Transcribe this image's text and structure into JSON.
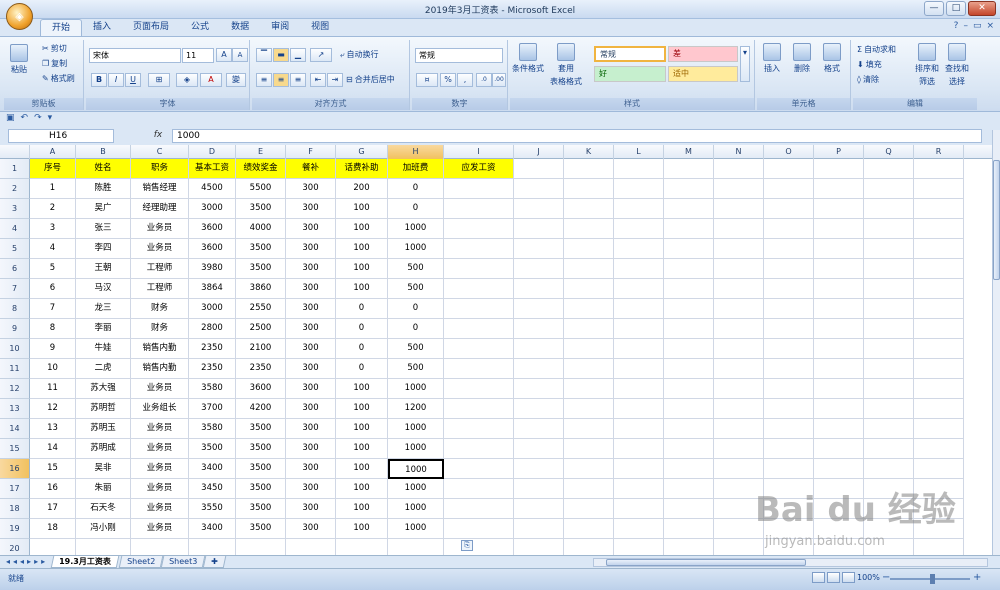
{
  "window": {
    "title": "2019年3月工资表 - Microsoft Excel",
    "controls": [
      "—",
      "□",
      "✕"
    ]
  },
  "ribbon_tabs": [
    "开始",
    "插入",
    "页面布局",
    "公式",
    "数据",
    "审阅",
    "视图"
  ],
  "active_tab": "开始",
  "clipboard": {
    "paste": "粘贴",
    "cut": "剪切",
    "copy": "复制",
    "format_painter": "格式刷",
    "label": "剪贴板"
  },
  "font": {
    "name": "宋体",
    "size": "11",
    "bold": "B",
    "italic": "I",
    "underline": "U",
    "grow": "A",
    "shrink": "A",
    "color_a": "A",
    "label": "字体"
  },
  "alignment": {
    "wrap": "自动换行",
    "merge": "合并后居中",
    "label": "对齐方式"
  },
  "number": {
    "format": "常规",
    "percent": "%",
    "comma": ",",
    "inc": ".0",
    "dec": ".00",
    "label": "数字"
  },
  "styles": {
    "cond_format": "条件格式",
    "table_format_1": "套用",
    "table_format_2": "表格格式",
    "normal": "常规",
    "bad": "差",
    "good": "好",
    "neutral": "适中",
    "label": "样式"
  },
  "cells_group": {
    "insert": "插入",
    "delete": "删除",
    "format": "格式",
    "label": "单元格"
  },
  "editing": {
    "autosum": "自动求和",
    "fill": "填充",
    "clear": "清除",
    "sort_1": "排序和",
    "sort_2": "筛选",
    "find_1": "查找和",
    "find_2": "选择",
    "label": "编辑"
  },
  "formula_bar": {
    "name_box": "H16",
    "fx": "fx",
    "value": "1000"
  },
  "columns": [
    "A",
    "B",
    "C",
    "D",
    "E",
    "F",
    "G",
    "H",
    "I",
    "J",
    "K",
    "L",
    "M",
    "N",
    "O",
    "P",
    "Q",
    "R"
  ],
  "row_numbers": [
    "1",
    "2",
    "3",
    "4",
    "5",
    "6",
    "7",
    "8",
    "9",
    "10",
    "11",
    "12",
    "13",
    "14",
    "15",
    "16",
    "17",
    "18",
    "19",
    "20"
  ],
  "table_headers": [
    "序号",
    "姓名",
    "职务",
    "基本工资",
    "绩效奖金",
    "餐补",
    "话费补助",
    "加班费",
    "应发工资"
  ],
  "table_rows": [
    [
      "1",
      "陈胜",
      "销售经理",
      "4500",
      "5500",
      "300",
      "200",
      "0",
      ""
    ],
    [
      "2",
      "吴广",
      "经理助理",
      "3000",
      "3500",
      "300",
      "100",
      "0",
      ""
    ],
    [
      "3",
      "张三",
      "业务员",
      "3600",
      "4000",
      "300",
      "100",
      "1000",
      ""
    ],
    [
      "4",
      "李四",
      "业务员",
      "3600",
      "3500",
      "300",
      "100",
      "1000",
      ""
    ],
    [
      "5",
      "王朝",
      "工程师",
      "3980",
      "3500",
      "300",
      "100",
      "500",
      ""
    ],
    [
      "6",
      "马汉",
      "工程师",
      "3864",
      "3860",
      "300",
      "100",
      "500",
      ""
    ],
    [
      "7",
      "龙三",
      "财务",
      "3000",
      "2550",
      "300",
      "0",
      "0",
      ""
    ],
    [
      "8",
      "李丽",
      "财务",
      "2800",
      "2500",
      "300",
      "0",
      "0",
      ""
    ],
    [
      "9",
      "牛娃",
      "销售内勤",
      "2350",
      "2100",
      "300",
      "0",
      "500",
      ""
    ],
    [
      "10",
      "二虎",
      "销售内勤",
      "2350",
      "2350",
      "300",
      "0",
      "500",
      ""
    ],
    [
      "11",
      "苏大强",
      "业务员",
      "3580",
      "3600",
      "300",
      "100",
      "1000",
      ""
    ],
    [
      "12",
      "苏明哲",
      "业务组长",
      "3700",
      "4200",
      "300",
      "100",
      "1200",
      ""
    ],
    [
      "13",
      "苏明玉",
      "业务员",
      "3580",
      "3500",
      "300",
      "100",
      "1000",
      ""
    ],
    [
      "14",
      "苏明成",
      "业务员",
      "3500",
      "3500",
      "300",
      "100",
      "1000",
      ""
    ],
    [
      "15",
      "吴非",
      "业务员",
      "3400",
      "3500",
      "300",
      "100",
      "1000",
      ""
    ],
    [
      "16",
      "朱丽",
      "业务员",
      "3450",
      "3500",
      "300",
      "100",
      "1000",
      ""
    ],
    [
      "17",
      "石天冬",
      "业务员",
      "3550",
      "3500",
      "300",
      "100",
      "1000",
      ""
    ],
    [
      "18",
      "冯小刚",
      "业务员",
      "3400",
      "3500",
      "300",
      "100",
      "1000",
      ""
    ]
  ],
  "active_cell": "H16",
  "sheet_tabs": [
    "19.3月工资表",
    "Sheet2",
    "Sheet3"
  ],
  "active_sheet": "19.3月工资表",
  "status": {
    "ready": "就绪",
    "zoom": "100%"
  },
  "watermark": {
    "brand": "Bai du 经验",
    "url": "jingyan.baidu.com"
  },
  "colors": {
    "header_fill": "#ffff00",
    "selection_header": "#f1c15f",
    "ribbon": "#dae6f4"
  }
}
